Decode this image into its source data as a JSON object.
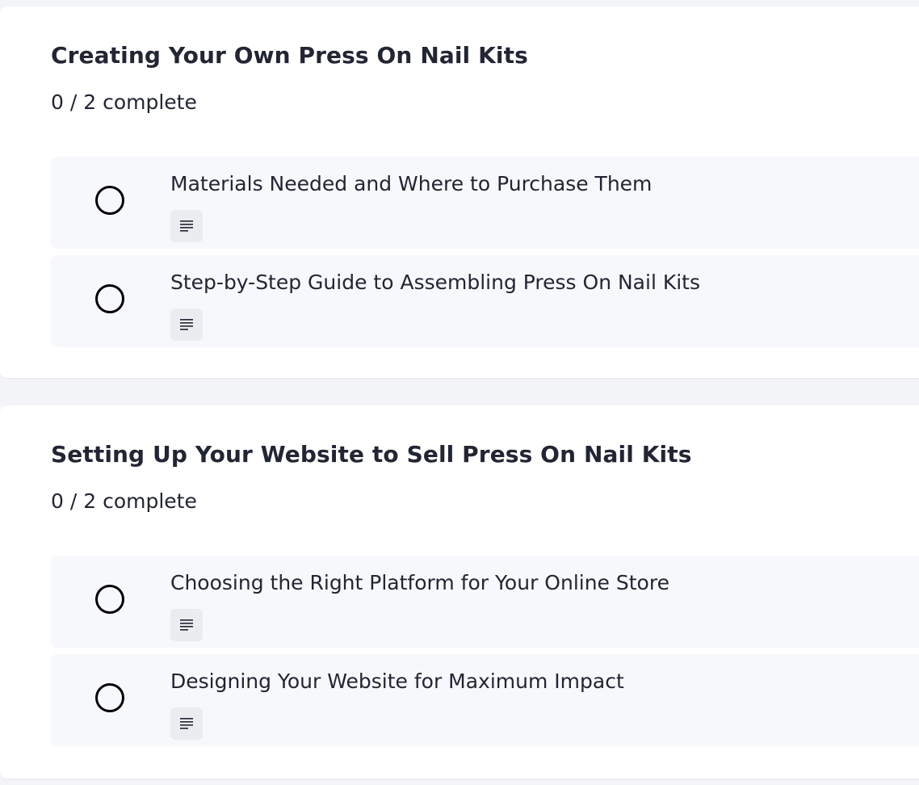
{
  "modules": [
    {
      "title": "Creating Your Own Press On Nail Kits",
      "progress": "0 / 2 complete",
      "lessons": [
        {
          "title": "Materials Needed and Where to Purchase Them",
          "type_icon": "document-icon",
          "completed": false
        },
        {
          "title": "Step-by-Step Guide to Assembling Press On Nail Kits",
          "type_icon": "document-icon",
          "completed": false
        }
      ]
    },
    {
      "title": "Setting Up Your Website to Sell Press On Nail Kits",
      "progress": "0 / 2 complete",
      "lessons": [
        {
          "title": "Choosing the Right Platform for Your Online Store",
          "type_icon": "document-icon",
          "completed": false
        },
        {
          "title": "Designing Your Website for Maximum Impact",
          "type_icon": "document-icon",
          "completed": false
        }
      ]
    }
  ],
  "colors": {
    "page_background": "#f3f4f7",
    "card_background": "#ffffff",
    "lesson_background": "#f7f8fb",
    "text": "#222533",
    "icon_badge": "#ebecf0"
  }
}
